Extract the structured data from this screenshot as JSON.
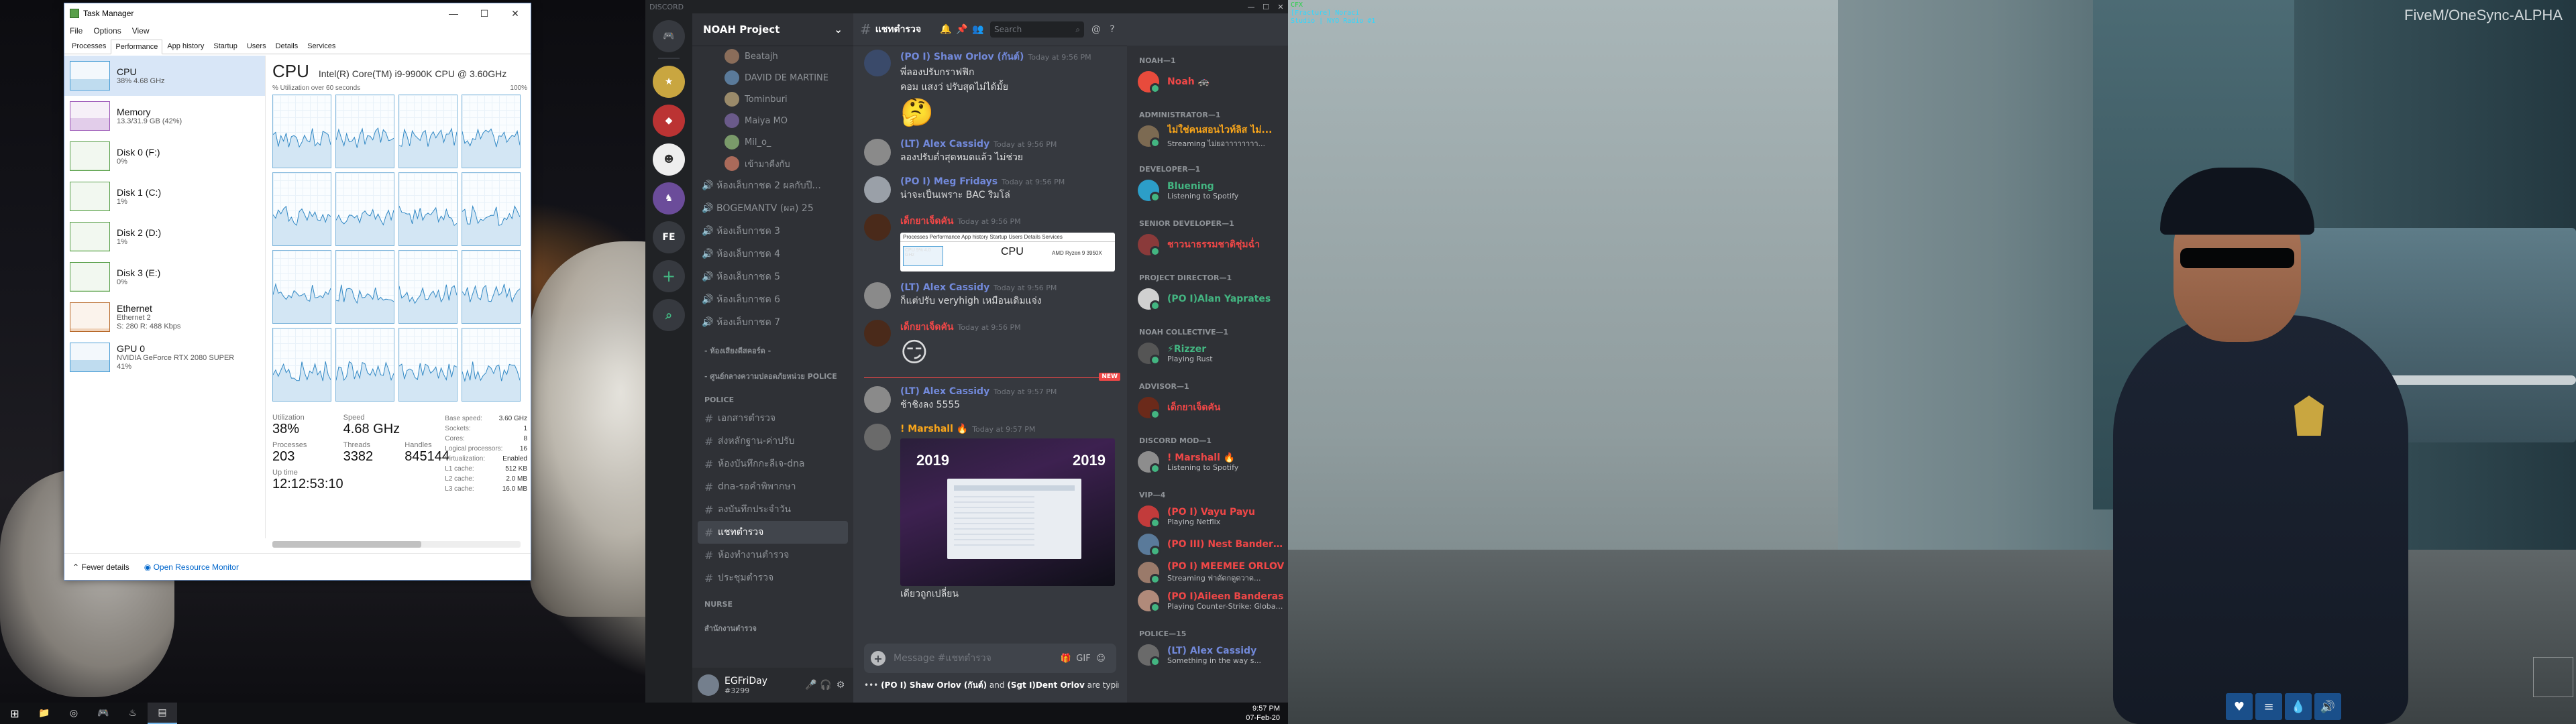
{
  "taskmgr": {
    "title": "Task Manager",
    "menu": [
      "File",
      "Options",
      "View"
    ],
    "tabs": [
      "Processes",
      "Performance",
      "App history",
      "Startup",
      "Users",
      "Details",
      "Services"
    ],
    "active_tab": "Performance",
    "resources": [
      {
        "name": "CPU",
        "sub": "38% 4.68 GHz",
        "kind": "cpu",
        "level": 0.38
      },
      {
        "name": "Memory",
        "sub": "13.3/31.9 GB (42%)",
        "kind": "mem",
        "level": 0.42
      },
      {
        "name": "Disk 0 (F:)",
        "sub": "0%",
        "kind": "disk",
        "level": 0.0
      },
      {
        "name": "Disk 1 (C:)",
        "sub": "1%",
        "kind": "disk",
        "level": 0.01
      },
      {
        "name": "Disk 2 (D:)",
        "sub": "1%",
        "kind": "disk",
        "level": 0.01
      },
      {
        "name": "Disk 3 (E:)",
        "sub": "0%",
        "kind": "disk",
        "level": 0.0
      },
      {
        "name": "Ethernet",
        "sub": "Ethernet 2",
        "sub2": "S: 280 R: 488 Kbps",
        "kind": "eth",
        "level": 0.1
      },
      {
        "name": "GPU 0",
        "sub": "NVIDIA GeForce RTX 2080 SUPER",
        "sub2": "41%",
        "kind": "cpu",
        "level": 0.41
      }
    ],
    "cpu_title": "CPU",
    "cpu_model": "Intel(R) Core(TM) i9-9900K CPU @ 3.60GHz",
    "util_label": "% Utilization over 60 seconds",
    "util_max": "100%",
    "stats": {
      "utilization_label": "Utilization",
      "utilization": "38%",
      "speed_label": "Speed",
      "speed": "4.68 GHz",
      "processes_label": "Processes",
      "processes": "203",
      "threads_label": "Threads",
      "threads": "3382",
      "handles_label": "Handles",
      "handles": "845144",
      "uptime_label": "Up time",
      "uptime": "12:12:53:10"
    },
    "specs": [
      {
        "k": "Base speed:",
        "v": "3.60 GHz"
      },
      {
        "k": "Sockets:",
        "v": "1"
      },
      {
        "k": "Cores:",
        "v": "8"
      },
      {
        "k": "Logical processors:",
        "v": "16"
      },
      {
        "k": "Virtualization:",
        "v": "Enabled"
      },
      {
        "k": "L1 cache:",
        "v": "512 KB"
      },
      {
        "k": "L2 cache:",
        "v": "2.0 MB"
      },
      {
        "k": "L3 cache:",
        "v": "16.0 MB"
      }
    ],
    "fewer_details": "Fewer details",
    "resource_monitor": "Open Resource Monitor"
  },
  "discord": {
    "app_title": "DISCORD",
    "server_name": "NOAH Project",
    "guild_initials": "FE",
    "voice_users": [
      "Beatajh",
      "DAVID DE MARTINE",
      "Tominburi",
      "Maiya MO",
      "Mil_o_",
      "เข้ามาคืงกับ"
    ],
    "voice_channels": [
      "ห้องเล็บกาชด 2 ผลกับปี...",
      "BOGEMANTV (ผล) 25",
      "ห้องเล็บกาชด 3",
      "ห้องเล็บกาชด 4",
      "ห้องเล็บกาชด 5",
      "ห้องเล็บกาชด 6",
      "ห้องเล็บกาชด 7"
    ],
    "categories": {
      "c1": "- ห้องเสียงดีสคอร์ด -",
      "c2": "- ศูนย์กลางความปลอดภัยหน่วย POLICE",
      "police": "POLICE",
      "nurse": "NURSE",
      "other": "สำนักงานตำรวจ"
    },
    "text_channels": [
      "เอกสารตำรวจ",
      "ส่งหลักฐาน-ค่าปรับ",
      "ห้องบันทึกกะลีเจ-dna",
      "dna-รอคำพิพากษา",
      "ลงบันทึกประจำวัน",
      "แชทตำรวจ",
      "ห้องทำงานตำรวจ",
      "ประชุมตำรวจ"
    ],
    "active_channel": "แชทตำรวจ",
    "user": {
      "name": "EGFriDay",
      "tag": "#3299"
    },
    "channel_title": "แชทตำรวจ",
    "search_placeholder": "Search",
    "messages": [
      {
        "author": "(PO I) Shaw Orlov (กันต์)",
        "color": "blue",
        "time": "Today at 9:56 PM",
        "text": "พี่ลองปรับกราฟฟิก",
        "text2": "คอม แสงว่ ปรับสุดไม่ได้มั้ย",
        "emoji": "🤔"
      },
      {
        "author": "(LT) Alex Cassidy",
        "color": "blue",
        "time": "Today at 9:56 PM",
        "text": "ลองปรับต่ำสุดหมดแล้ว ไม่ช่วย"
      },
      {
        "author": "(PO I) Meg Fridays",
        "color": "blue",
        "time": "Today at 9:56 PM",
        "text": "น่าจะเป็นเพราะ BAC ริมโล่"
      },
      {
        "author": "เด็กยาเจ็ดคัน",
        "color": "red",
        "time": "Today at 9:56 PM",
        "embed": "cpu"
      },
      {
        "author": "(LT) Alex Cassidy",
        "color": "blue",
        "time": "Today at 9:56 PM",
        "text": "ก็แต่ปรับ veryhigh เหมือนเดิมแจ่ง"
      },
      {
        "author": "เด็กยาเจ็ดคัน",
        "color": "red",
        "time": "Today at 9:56 PM",
        "emoji": "😏"
      },
      {
        "author": "(LT) Alex Cassidy",
        "color": "blue",
        "time": "Today at 9:57 PM",
        "text": "ช้าชิงลง 5555",
        "new": true
      },
      {
        "author": "! Marshall 🔥",
        "color": "orange",
        "time": "Today at 9:57 PM",
        "embed": "video",
        "text_after": "เดียวถูกเปลี่ยน"
      }
    ],
    "embed_cpu": {
      "tabs": "Processes  Performance  App history  Startup  Users  Details  Services",
      "cpu": "CPU",
      "model": "AMD Ryzen 9 3950X",
      "mini": "CPU 9% 4.0 GHz"
    },
    "embed_video": {
      "year1": "2019",
      "year2": "2019"
    },
    "new_label": "NEW",
    "input_placeholder": "Message #แชทตำรวจ",
    "typing": {
      "a": "(PO I) Shaw Orlov (กันต์)",
      "and": " and ",
      "b": "(Sgt I)Dent Orlov",
      "rest": " are typing..."
    },
    "members": [
      {
        "role": "NOAH—1",
        "items": [
          {
            "name": "Noah 🚓",
            "status": "",
            "color": "#f04747",
            "av": "#e84b3c"
          }
        ]
      },
      {
        "role": "ADMINISTRATOR—1",
        "items": [
          {
            "name": "ไม่ใช่คนสอนไวท์ลิส ไม่...",
            "status": "Streaming ไม่ยอาาาาาาาา...",
            "color": "#faa61a",
            "av": "#7c6a52"
          }
        ]
      },
      {
        "role": "DEVELOPER—1",
        "items": [
          {
            "name": "Bluening",
            "status": "Listening to Spotify",
            "color": "#43b581",
            "av": "#2c9ec8"
          }
        ]
      },
      {
        "role": "SENIOR DEVELOPER—1",
        "items": [
          {
            "name": "ชาวนาธรรมชาติชุ่มฉ่ำ",
            "status": "",
            "color": "#f04747",
            "av": "#8a3a3a"
          }
        ]
      },
      {
        "role": "PROJECT DIRECTOR—1",
        "items": [
          {
            "name": "(PO I)Alan Yaprates",
            "status": "",
            "color": "#43b581",
            "av": "#d0d0d0"
          }
        ]
      },
      {
        "role": "NOAH COLLECTIVE—1",
        "items": [
          {
            "name": "⚡Rizzer",
            "status": "Playing Rust",
            "color": "#43b581",
            "av": "#555"
          }
        ]
      },
      {
        "role": "ADVISOR—1",
        "items": [
          {
            "name": "เด็กยาเจ็ดคัน",
            "status": "",
            "color": "#f04747",
            "av": "#6b2a1a"
          }
        ]
      },
      {
        "role": "DISCORD MOD—1",
        "items": [
          {
            "name": "! Marshall 🔥",
            "status": "Listening to Spotify",
            "color": "#f04747",
            "av": "#8d8d8d"
          }
        ]
      },
      {
        "role": "VIP—4",
        "items": [
          {
            "name": "(PO I) Vayu Payu",
            "status": "Playing Netflix",
            "color": "#f04747",
            "av": "#c23b3b"
          },
          {
            "name": "(PO III) Nest Banderas...",
            "status": "",
            "color": "#f04747",
            "av": "#5a7a9a"
          },
          {
            "name": "(PO I) MEEMEE ORLOV",
            "status": "Streaming ฟาดัดกดูดวาด...",
            "color": "#f04747",
            "av": "#9a7a6a"
          },
          {
            "name": "(PO I)Aileen Banderas",
            "status": "Playing Counter-Strike: Global...",
            "color": "#f04747",
            "av": "#b08a7a"
          }
        ]
      },
      {
        "role": "POLICE—15",
        "items": [
          {
            "name": "(LT) Alex Cassidy",
            "status": "Something in the way s...",
            "color": "#7289da",
            "av": "#6a6a6a"
          }
        ]
      }
    ]
  },
  "game": {
    "hud_line1": "CFX",
    "hud_line2": "[Fracture] Noraci",
    "hud_line3": "Studio | NYO Radio #1",
    "brand": "FiveM/OneSync-ALPHA",
    "hud_icons": [
      "heart-icon",
      "burger-icon",
      "droplet-icon",
      "speaker-icon"
    ]
  },
  "taskbar": {
    "time": "9:57 PM",
    "date": "07-Feb-20"
  }
}
